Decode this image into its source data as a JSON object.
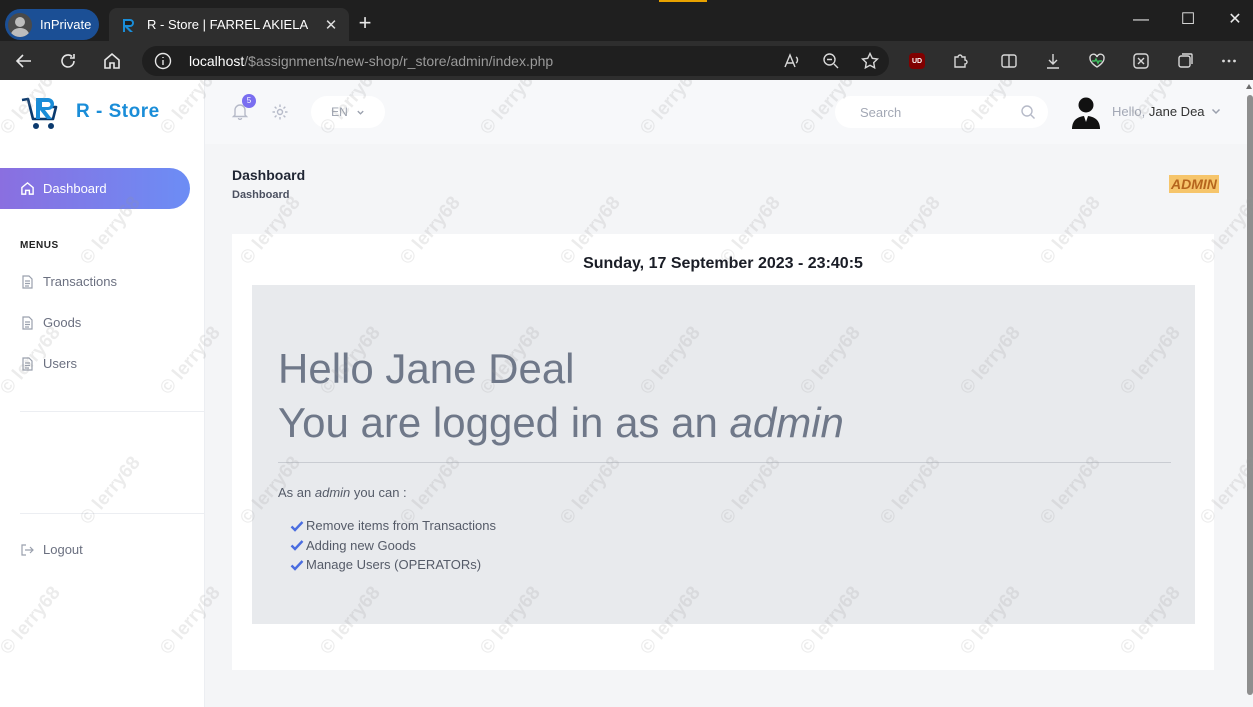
{
  "browser": {
    "inprivate_label": "InPrivate",
    "tab_title": "R - Store | FARREL AKIELA",
    "tab_close": "✕",
    "new_tab": "+",
    "url_host": "localhost",
    "url_path": "/$assignments/new-shop/r_store/admin/index.php"
  },
  "sidebar": {
    "brand_name": "R - Store",
    "dashboard_label": "Dashboard",
    "menu_title": "MENUS",
    "items": [
      {
        "label": "Transactions",
        "icon": "document-icon"
      },
      {
        "label": "Goods",
        "icon": "document-icon"
      },
      {
        "label": "Users",
        "icon": "document-icon"
      }
    ],
    "logout_label": "Logout"
  },
  "topbar": {
    "notification_count": "5",
    "language": "EN",
    "search_placeholder": "Search",
    "hello_prefix": "Hello,",
    "user_name": "Jane Dea"
  },
  "page": {
    "title": "Dashboard",
    "breadcrumb": "Dashboard",
    "role_badge": "ADMIN"
  },
  "card": {
    "datetime": "Sunday, 17 September 2023 - 23:40:5",
    "greeting_line1": "Hello Jane Deal",
    "greeting_line2_prefix": "You are logged in as an ",
    "greeting_line2_role": "admin",
    "caption_prefix": "As an ",
    "caption_role": "admin",
    "caption_suffix": " you can :",
    "capabilities": [
      "Remove items from Transactions",
      "Adding new Goods",
      "Manage Users (OPERATORs)"
    ]
  },
  "watermark_text": "© lerry68",
  "colors": {
    "accent_gradient_start": "#8a6fe0",
    "accent_gradient_end": "#6c8df5",
    "brand": "#1a8dd8",
    "badge": "#f6c56b",
    "check": "#4a6de0"
  }
}
